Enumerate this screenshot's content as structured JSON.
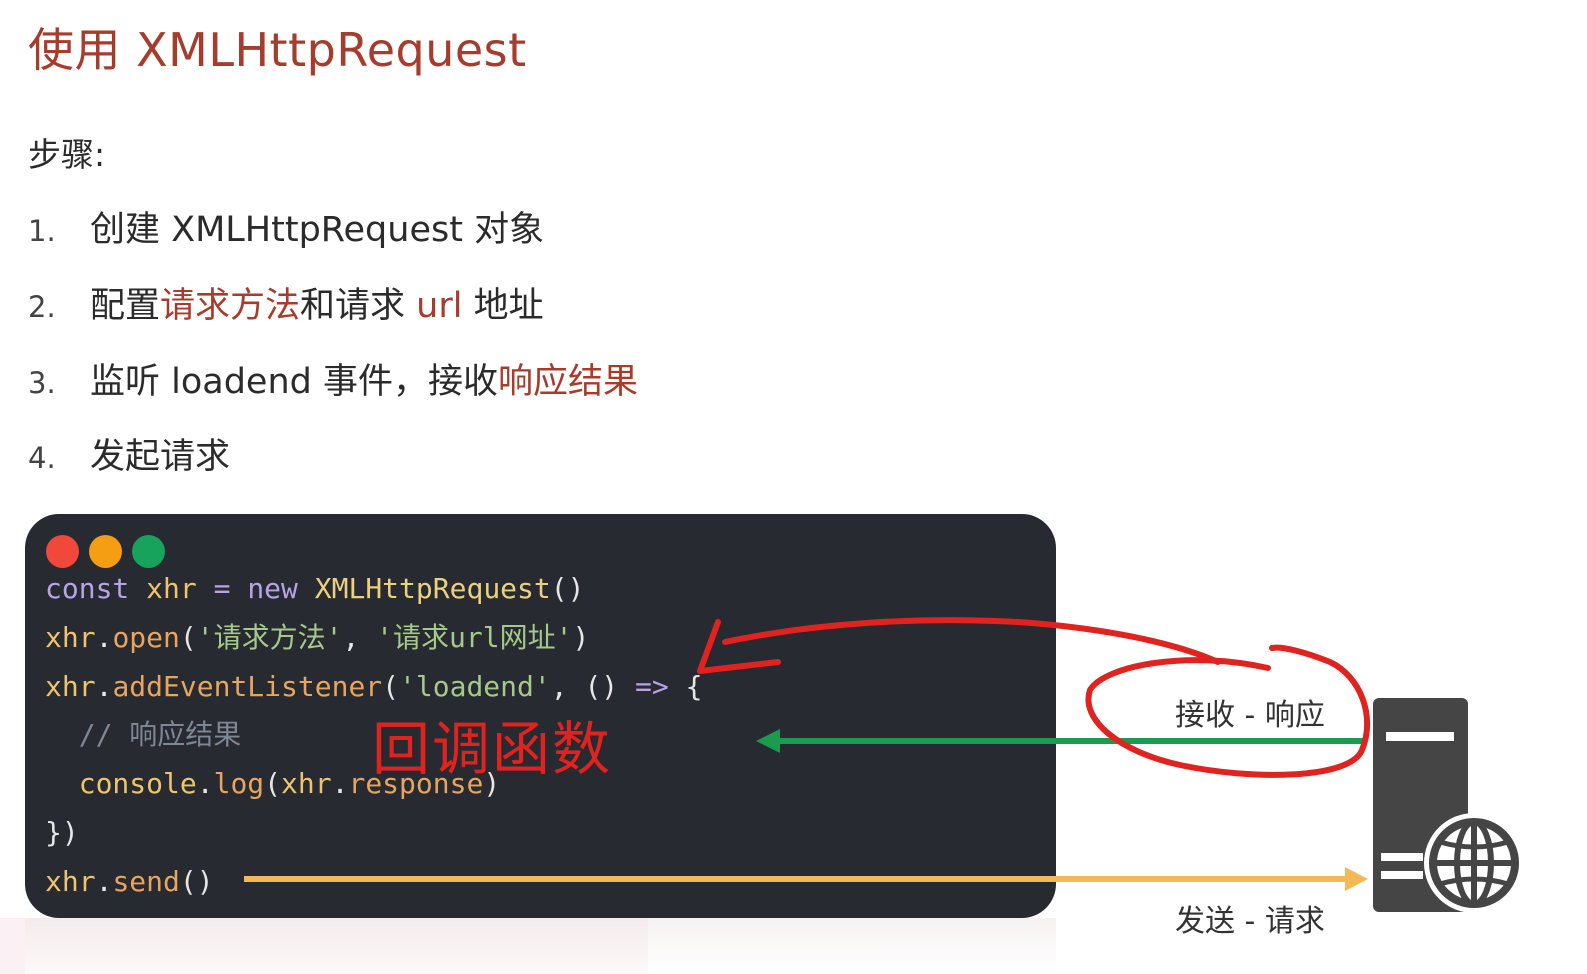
{
  "title": "使用 XMLHttpRequest",
  "steps_label": "步骤:",
  "steps": [
    {
      "num": "1.",
      "parts": [
        "创建 XMLHttpRequest 对象"
      ]
    },
    {
      "num": "2.",
      "parts": [
        "配置",
        "请求方法",
        "和请求 ",
        "url",
        " 地址"
      ]
    },
    {
      "num": "3.",
      "parts": [
        "监听 loadend 事件，接收",
        "响应结果"
      ]
    },
    {
      "num": "4.",
      "parts": [
        "发起请求"
      ]
    }
  ],
  "code_lines": [
    "const xhr = new XMLHttpRequest()",
    "xhr.open('请求方法', '请求url网址')",
    "xhr.addEventListener('loadend', () => {",
    "  // 响应结果",
    "  console.log(xhr.response)",
    "})",
    "xhr.send()"
  ],
  "annotation": "回调函数",
  "receive_label": "接收 - 响应",
  "send_label": "发送 - 请求",
  "colors": {
    "title": "#a63c2c",
    "highlight": "#a63c2c",
    "code_bg": "#272a30",
    "annotation": "#e0231f",
    "response_arrow": "#1c9b4f",
    "request_arrow": "#f2b957",
    "server": "#454545"
  },
  "icons": [
    "window-close-dot",
    "window-minimize-dot",
    "window-maximize-dot",
    "server-icon",
    "globe-icon"
  ]
}
